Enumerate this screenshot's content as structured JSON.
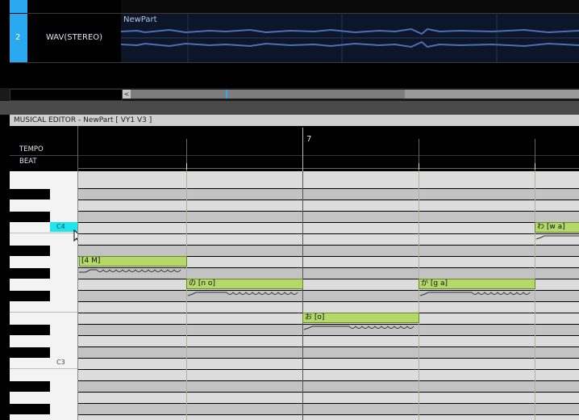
{
  "arranger": {
    "track": {
      "number": "2",
      "name": "WAV(STEREO)"
    },
    "part_label": "NewPart"
  },
  "scrollbar": {
    "left_arrow": "<"
  },
  "editor": {
    "title": "MUSICAL EDITOR - NewPart [ VY1 V3 ]",
    "tempo_label": "TEMPO",
    "beat_label": "BEAT",
    "measure_number": "7"
  },
  "piano": {
    "c4_label": "C4",
    "c3_label": "C3"
  },
  "notes": [
    {
      "label": "[4 M]"
    },
    {
      "label": "の [n o]"
    },
    {
      "label": "お [o]"
    },
    {
      "label": "が [g a]"
    },
    {
      "label": "わ [w a]"
    }
  ],
  "colors": {
    "accent": "#2aa8f0",
    "note_fill": "#b4d96a",
    "selected_key": "#1ee6ee"
  },
  "icons": {
    "cursor": "mouse-cursor-icon"
  }
}
